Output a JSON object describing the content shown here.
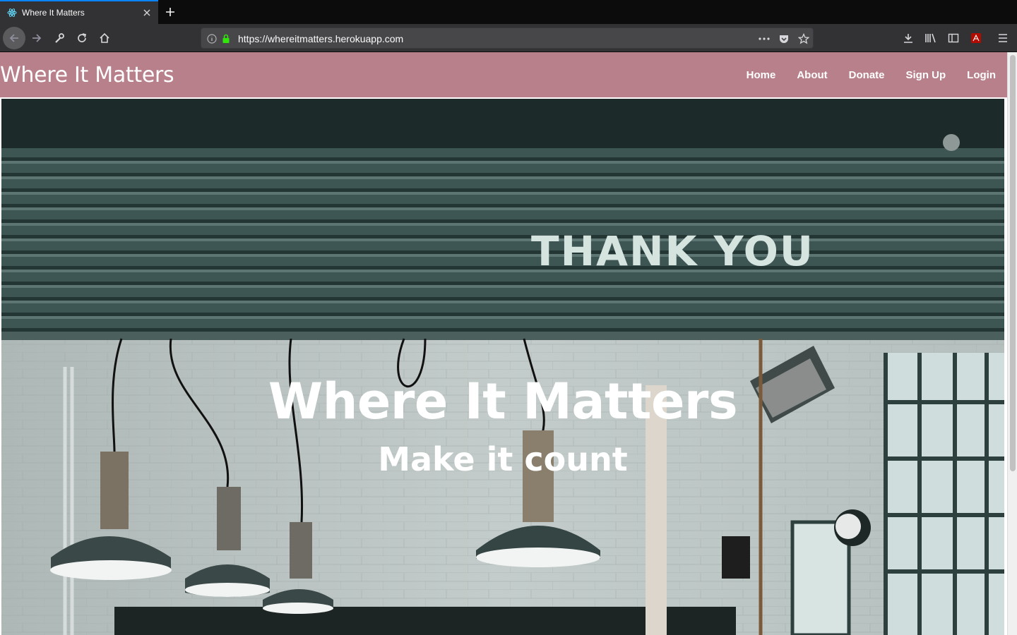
{
  "browser": {
    "tab": {
      "title": "Where It Matters",
      "favicon": "react-atom-icon"
    },
    "url": "https://whereitmatters.herokuapp.com",
    "accent_color": "#0a84ff"
  },
  "site": {
    "brand": "Where It Matters",
    "header_color": "#b8808a",
    "nav": [
      {
        "label": "Home"
      },
      {
        "label": "About"
      },
      {
        "label": "Donate"
      },
      {
        "label": "Sign Up"
      },
      {
        "label": "Login"
      }
    ]
  },
  "hero": {
    "title": "Where It Matters",
    "subtitle": "Make it count",
    "sign_text": "THANK YOU"
  }
}
